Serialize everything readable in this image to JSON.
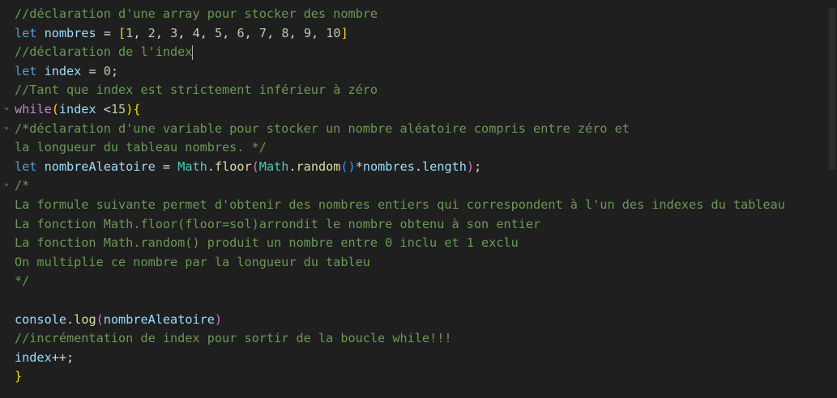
{
  "colors": {
    "background": "#1f1f1f",
    "comment": "#6a9955",
    "keyword": "#569cd6",
    "control": "#c586c0",
    "variable": "#9cdcfe",
    "function": "#dcdcaa",
    "class": "#4ec9b0",
    "number": "#b5cea8",
    "bracket1": "#ffd700",
    "bracket2": "#da70d6",
    "bracket3": "#179fff"
  },
  "code": {
    "lines": [
      [
        [
          "comment",
          "//déclaration d'une array pour stocker des nombre"
        ]
      ],
      [
        [
          "keyword",
          "let"
        ],
        [
          "op",
          " "
        ],
        [
          "var",
          "nombres"
        ],
        [
          "op",
          " = "
        ],
        [
          "b1",
          "["
        ],
        [
          "num",
          "1"
        ],
        [
          "op",
          ", "
        ],
        [
          "num",
          "2"
        ],
        [
          "op",
          ", "
        ],
        [
          "num",
          "3"
        ],
        [
          "op",
          ", "
        ],
        [
          "num",
          "4"
        ],
        [
          "op",
          ", "
        ],
        [
          "num",
          "5"
        ],
        [
          "op",
          ", "
        ],
        [
          "num",
          "6"
        ],
        [
          "op",
          ", "
        ],
        [
          "num",
          "7"
        ],
        [
          "op",
          ", "
        ],
        [
          "num",
          "8"
        ],
        [
          "op",
          ", "
        ],
        [
          "num",
          "9"
        ],
        [
          "op",
          ", "
        ],
        [
          "num",
          "10"
        ],
        [
          "b1",
          "]"
        ]
      ],
      [
        [
          "comment",
          "//déclaration de l'index"
        ],
        [
          "cursor",
          ""
        ]
      ],
      [
        [
          "keyword",
          "let"
        ],
        [
          "op",
          " "
        ],
        [
          "var",
          "index"
        ],
        [
          "op",
          " = "
        ],
        [
          "num",
          "0"
        ],
        [
          "op",
          ";"
        ]
      ],
      [
        [
          "comment",
          "//Tant que index est strictement inférieur à zéro"
        ]
      ],
      [
        [
          "control",
          "while"
        ],
        [
          "b1",
          "("
        ],
        [
          "var",
          "index"
        ],
        [
          "op",
          " <"
        ],
        [
          "num",
          "15"
        ],
        [
          "b1",
          ")"
        ],
        [
          "b1",
          "{"
        ]
      ],
      [
        [
          "comment",
          "/*déclaration d'une variable pour stocker un nombre aléatoire compris entre zéro et"
        ]
      ],
      [
        [
          "comment",
          "la longueur du tableau nombres. */"
        ]
      ],
      [
        [
          "keyword",
          "let"
        ],
        [
          "op",
          " "
        ],
        [
          "var",
          "nombreAleatoire"
        ],
        [
          "op",
          " = "
        ],
        [
          "class",
          "Math"
        ],
        [
          "op",
          "."
        ],
        [
          "fn",
          "floor"
        ],
        [
          "b2",
          "("
        ],
        [
          "class",
          "Math"
        ],
        [
          "op",
          "."
        ],
        [
          "fn",
          "random"
        ],
        [
          "b3",
          "()"
        ],
        [
          "op",
          "*"
        ],
        [
          "var",
          "nombres"
        ],
        [
          "op",
          "."
        ],
        [
          "var",
          "length"
        ],
        [
          "b2",
          ")"
        ],
        [
          "op",
          ";"
        ]
      ],
      [
        [
          "comment",
          "/*"
        ]
      ],
      [
        [
          "comment",
          "La formule suivante permet d'obtenir des nombres entiers qui correspondent à l'un des indexes du tableau"
        ]
      ],
      [
        [
          "comment",
          "La fonction Math.floor(floor=sol)arrondit le nombre obtenu à son entier"
        ]
      ],
      [
        [
          "comment",
          "La fonction Math.random() produit un nombre entre 0 inclu et 1 exclu"
        ]
      ],
      [
        [
          "comment",
          "On multiplie ce nombre par la longueur du tableu"
        ]
      ],
      [
        [
          "comment",
          "*/"
        ]
      ],
      [
        [
          "op",
          ""
        ]
      ],
      [
        [
          "var",
          "console"
        ],
        [
          "op",
          "."
        ],
        [
          "fn",
          "log"
        ],
        [
          "b2",
          "("
        ],
        [
          "var",
          "nombreAleatoire"
        ],
        [
          "b2",
          ")"
        ]
      ],
      [
        [
          "comment",
          "//incrémentation de index pour sortir de la boucle while!!!"
        ]
      ],
      [
        [
          "var",
          "index"
        ],
        [
          "op",
          "++;"
        ]
      ],
      [
        [
          "b1",
          "}"
        ]
      ]
    ],
    "fold_icons": [
      {
        "line": 5,
        "icon": "chevron-down-icon",
        "glyph": "⌄"
      },
      {
        "line": 6,
        "icon": "chevron-down-icon",
        "glyph": "⌄"
      },
      {
        "line": 9,
        "icon": "chevron-down-icon",
        "glyph": "⌄"
      }
    ]
  }
}
